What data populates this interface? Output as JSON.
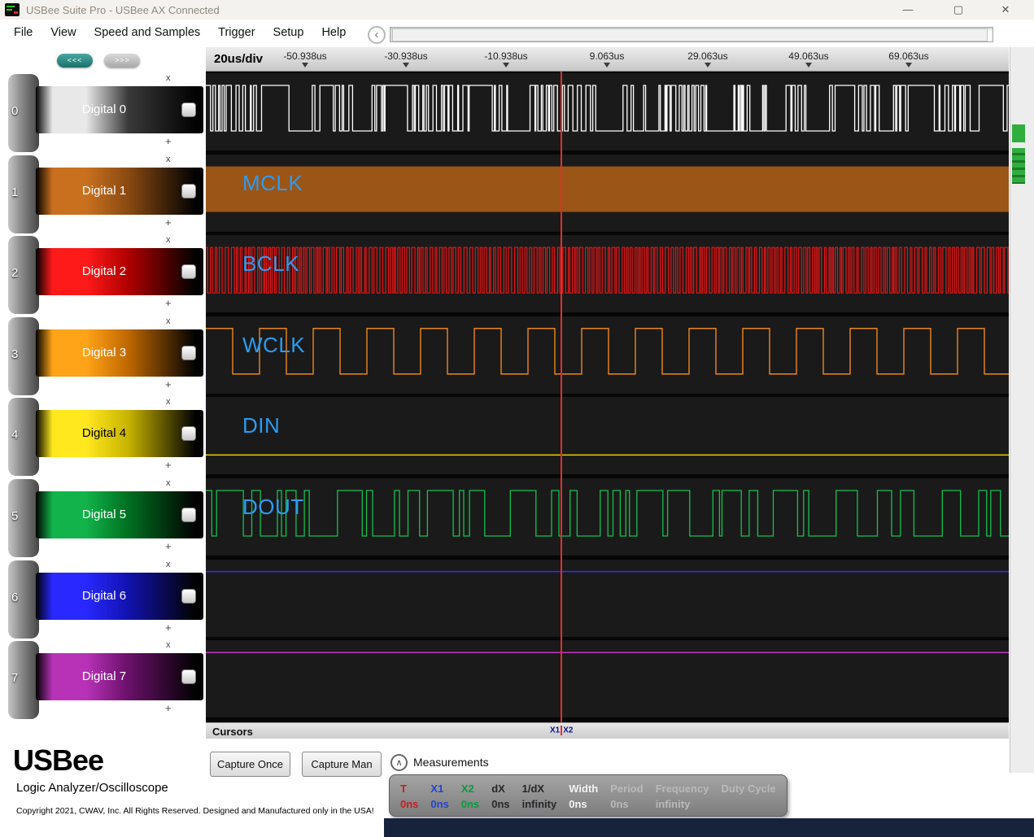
{
  "titlebar": {
    "title": "USBee Suite Pro - USBee AX Connected"
  },
  "icons": {
    "minimize": "—",
    "maximize": "▢",
    "close": "✕",
    "scroll_left": "‹",
    "chevron_up": "∧"
  },
  "menubar": {
    "items": [
      "File",
      "View",
      "Speed and Samples",
      "Trigger",
      "Setup",
      "Help"
    ]
  },
  "sidebar": {
    "collapse_label": "<<<",
    "expand_label": ">>>",
    "row_controls": {
      "close": "x",
      "expand": "+"
    }
  },
  "channels": [
    {
      "num": "0",
      "label": "Digital 0",
      "base": "#3a3a3a",
      "bright": "#e8e8e8",
      "text": "#ffffff",
      "wave": "burst",
      "wave_color": "#ffffff",
      "signal": ""
    },
    {
      "num": "1",
      "label": "Digital 1",
      "base": "#8a4a12",
      "bright": "#c9701e",
      "text": "#ffffff",
      "wave": "solid",
      "wave_color": "#9b5517",
      "signal": "MCLK"
    },
    {
      "num": "2",
      "label": "Digital 2",
      "base": "#b00000",
      "bright": "#ff1a1a",
      "text": "#ffffff",
      "wave": "dense-clock",
      "wave_color": "#e81515",
      "signal": "BCLK"
    },
    {
      "num": "3",
      "label": "Digital 3",
      "base": "#c06800",
      "bright": "#ffa318",
      "text": "#ffffff",
      "wave": "clock",
      "wave_color": "#ff9020",
      "signal": "WCLK"
    },
    {
      "num": "4",
      "label": "Digital 4",
      "base": "#c8b400",
      "bright": "#ffe81e",
      "text": "#000000",
      "wave": "flat-low",
      "wave_color": "#e8d400",
      "signal": "DIN"
    },
    {
      "num": "5",
      "label": "Digital 5",
      "base": "#007020",
      "bright": "#12b34a",
      "text": "#ffffff",
      "wave": "data",
      "wave_color": "#18c050",
      "signal": "DOUT"
    },
    {
      "num": "6",
      "label": "Digital 6",
      "base": "#1212b0",
      "bright": "#2828ff",
      "text": "#ffffff",
      "wave": "flat-high",
      "wave_color": "#3030ff",
      "signal": ""
    },
    {
      "num": "7",
      "label": "Digital 7",
      "base": "#6a106a",
      "bright": "#b832b8",
      "text": "#ffffff",
      "wave": "flat-high",
      "wave_color": "#c038c0",
      "signal": ""
    }
  ],
  "ruler": {
    "scale": "20us/div",
    "ticks": [
      "-50.938us",
      "-30.938us",
      "-10.938us",
      "9.063us",
      "29.063us",
      "49.063us",
      "69.063us"
    ]
  },
  "signal_label_color": "#2d9bf0",
  "cursor": {
    "bar_label": "Cursors",
    "x1": "X1",
    "x2": "X2",
    "color": "#e03030"
  },
  "footer": {
    "logo": "USBee",
    "subtitle": "Logic Analyzer/Oscilloscope",
    "copyright": "Copyright 2021, CWAV, Inc. All Rights Reserved. Designed and Manufactured only in the USA!",
    "buttons": {
      "capture_once": "Capture Once",
      "capture_manual": "Capture Man"
    },
    "measurements_label": "Measurements",
    "measurements": [
      {
        "label": "T",
        "value": "0ns",
        "color": "#c42020"
      },
      {
        "label": "X1",
        "value": "0ns",
        "color": "#2244cc"
      },
      {
        "label": "X2",
        "value": "0ns",
        "color": "#0a9a40"
      },
      {
        "label": "dX",
        "value": "0ns",
        "color": "#26262a"
      },
      {
        "label": "1/dX",
        "value": "infinity",
        "color": "#26262a"
      },
      {
        "label": "Width",
        "value": "0ns",
        "color": "#f2f2f2"
      },
      {
        "label": "Period",
        "value": "0ns",
        "color": "#b9b9b9"
      },
      {
        "label": "Frequency",
        "value": "infinity",
        "color": "#b9b9b9"
      },
      {
        "label": "Duty Cycle",
        "value": "",
        "color": "#b9b9b9"
      }
    ]
  }
}
